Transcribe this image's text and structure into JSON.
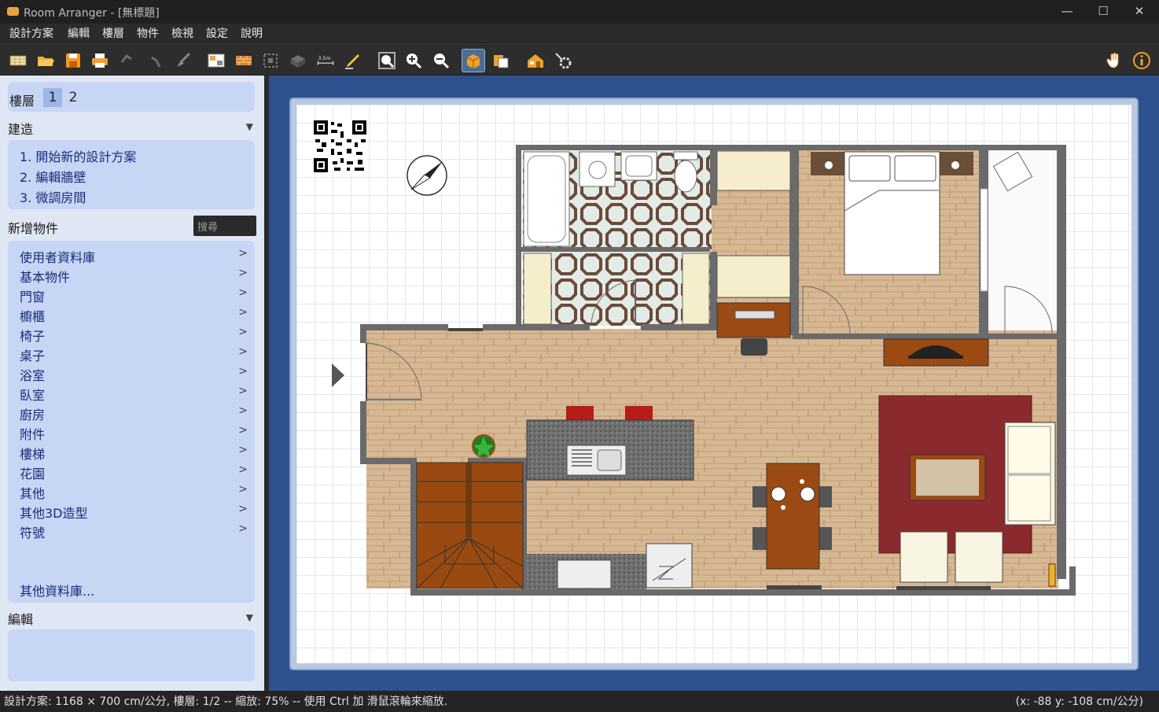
{
  "window": {
    "title": "Room Arranger - [無標題]",
    "min": "—",
    "max": "☐",
    "close": "✕"
  },
  "menu": [
    "設計方案",
    "編輯",
    "樓層",
    "物件",
    "檢視",
    "設定",
    "說明"
  ],
  "toolbar": {
    "icons": [
      "new-plan-icon",
      "open-icon",
      "save-icon",
      "print-icon",
      "undo-icon",
      "redo-icon",
      "clear-icon",
      "floor-plan-icon",
      "wall-icon",
      "select-icon",
      "3d-view-icon",
      "dimension-icon",
      "pencil-icon",
      "zoom-fit-icon",
      "zoom-in-icon",
      "zoom-out-icon",
      "object-box-icon",
      "objects-icon",
      "house-3d-icon",
      "settings-icon",
      "hand-icon",
      "info-icon"
    ],
    "dimension_label": "3.5m"
  },
  "sidebar": {
    "floors_label": "樓層",
    "floors": [
      "1",
      "2"
    ],
    "build_label": "建造",
    "build_items": [
      "1. 開始新的設計方案",
      "2. 編輯牆壁",
      "3. 微調房間"
    ],
    "add_label": "新增物件",
    "search_placeholder": "搜尋",
    "library": [
      "使用者資料庫",
      "基本物件",
      "門窗",
      "櫥櫃",
      "椅子",
      "桌子",
      "浴室",
      "臥室",
      "廚房",
      "附件",
      "樓梯",
      "花園",
      "其他",
      "其他3D造型",
      "符號"
    ],
    "more_libraries": "其他資料庫...",
    "edit_label": "編輯"
  },
  "status": {
    "left": "設計方案: 1168 × 700 cm/公分, 樓層: 1/2 -- 縮放: 75% -- 使用 Ctrl 加 滑鼠滾輪來縮放.",
    "right": "(x: -88 y: -108 cm/公分)"
  },
  "colors": {
    "accent": "#4c6e96",
    "canvas_bg": "#2e5190",
    "sidebar_bg": "#dfe6f4",
    "box_bg": "#c7d6f4",
    "floor_wood": "#d4b58e",
    "rug": "#8b2a2e"
  }
}
